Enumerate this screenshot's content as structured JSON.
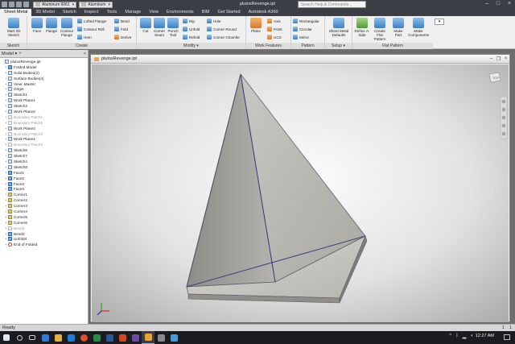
{
  "window": {
    "document_title": "plutosRevenge.ipt",
    "search_placeholder": "Search Help & Commands...",
    "material": "Aluminum 6061",
    "appearance": "Aluminum",
    "icons": [
      "save-icon",
      "undo-icon",
      "redo-icon",
      "home-icon"
    ]
  },
  "tabs": [
    "Sheet Metal",
    "3D Model",
    "Sketch",
    "Inspect",
    "Tools",
    "Manage",
    "View",
    "Environments",
    "BIM",
    "Get Started",
    "Autodesk A360"
  ],
  "ribbon": {
    "sketch": {
      "label": "Sketch",
      "start": "Start 2D Sketch"
    },
    "create": {
      "label": "Create",
      "face": "Face",
      "flange": "Flange",
      "contour_flange": "Contour Flange",
      "lofted_flange": "Lofted Flange",
      "contour_roll": "Contour Roll",
      "hem": "Hem",
      "bend": "Bend",
      "fold": "Fold",
      "derive": "Derive"
    },
    "modify": {
      "label": "Modify",
      "cut": "Cut",
      "corner_seam": "Corner Seam",
      "punch_tool": "Punch Tool",
      "rip": "Rip",
      "unfold": "Unfold",
      "refold": "Refold",
      "hole": "Hole",
      "corner_round": "Corner Round",
      "corner_chamfer": "Corner Chamfer"
    },
    "work": {
      "label": "Work Features",
      "plane": "Plane",
      "axis": "Axis",
      "point": "Point",
      "ucs": "UCS"
    },
    "pattern": {
      "label": "Pattern",
      "rectangular": "Rectangular",
      "circular": "Circular",
      "mirror": "Mirror"
    },
    "setup": {
      "label": "Setup",
      "defaults": "Sheet Metal Defaults"
    },
    "flat": {
      "label": "Flat Pattern",
      "define": "Define A-Side",
      "create": "Create Flat Pattern",
      "make_part": "Make Part",
      "make_components": "Make Components"
    }
  },
  "browser": {
    "title": "Model",
    "items": [
      {
        "label": "plutosRevenge.ipt",
        "depth": 0,
        "dim": false
      },
      {
        "label": "Folded Model",
        "depth": 1,
        "dim": false
      },
      {
        "label": "Solid Bodies(2)",
        "depth": 1,
        "dim": false
      },
      {
        "label": "Surface Bodies(4)",
        "depth": 1,
        "dim": false
      },
      {
        "label": "View: Master",
        "depth": 1,
        "dim": false
      },
      {
        "label": "Origin",
        "depth": 1,
        "dim": false
      },
      {
        "label": "Sketch1",
        "depth": 1,
        "dim": false
      },
      {
        "label": "Work Plane1",
        "depth": 1,
        "dim": false
      },
      {
        "label": "Sketch2",
        "depth": 1,
        "dim": false
      },
      {
        "label": "Work Plane2",
        "depth": 1,
        "dim": false
      },
      {
        "label": "Boundary Patch1",
        "depth": 1,
        "dim": true
      },
      {
        "label": "Boundary Patch2",
        "depth": 1,
        "dim": true
      },
      {
        "label": "Work Plane3",
        "depth": 1,
        "dim": false
      },
      {
        "label": "Boundary Patch3",
        "depth": 1,
        "dim": true
      },
      {
        "label": "Work Plane4",
        "depth": 1,
        "dim": false
      },
      {
        "label": "Boundary Patch4",
        "depth": 1,
        "dim": true
      },
      {
        "label": "Sketch6",
        "depth": 1,
        "dim": false
      },
      {
        "label": "Sketch7",
        "depth": 1,
        "dim": false
      },
      {
        "label": "Sketch4",
        "depth": 1,
        "dim": false
      },
      {
        "label": "Sketch8",
        "depth": 1,
        "dim": false
      },
      {
        "label": "Face1",
        "depth": 1,
        "dim": false
      },
      {
        "label": "Face2",
        "depth": 1,
        "dim": false
      },
      {
        "label": "Face3",
        "depth": 1,
        "dim": false
      },
      {
        "label": "Face4",
        "depth": 1,
        "dim": false
      },
      {
        "label": "Corner1",
        "depth": 1,
        "dim": false
      },
      {
        "label": "Corner2",
        "depth": 1,
        "dim": false
      },
      {
        "label": "Corner3",
        "depth": 1,
        "dim": false
      },
      {
        "label": "Corner4",
        "depth": 1,
        "dim": false
      },
      {
        "label": "Corner5",
        "depth": 1,
        "dim": false
      },
      {
        "label": "Corner6",
        "depth": 1,
        "dim": false
      },
      {
        "label": "Bend1",
        "depth": 1,
        "dim": true
      },
      {
        "label": "Bend2",
        "depth": 1,
        "dim": false
      },
      {
        "label": "Unfold4",
        "depth": 1,
        "dim": false
      },
      {
        "label": "End of Folded",
        "depth": 1,
        "dim": false
      }
    ]
  },
  "graphics": {
    "doc_tab": "plutosRevenge.ipt",
    "viewcube_label": "TOP"
  },
  "status": {
    "text": "Ready",
    "counts": [
      "1",
      "1"
    ]
  },
  "taskbar": {
    "time": "12:27 AM"
  }
}
